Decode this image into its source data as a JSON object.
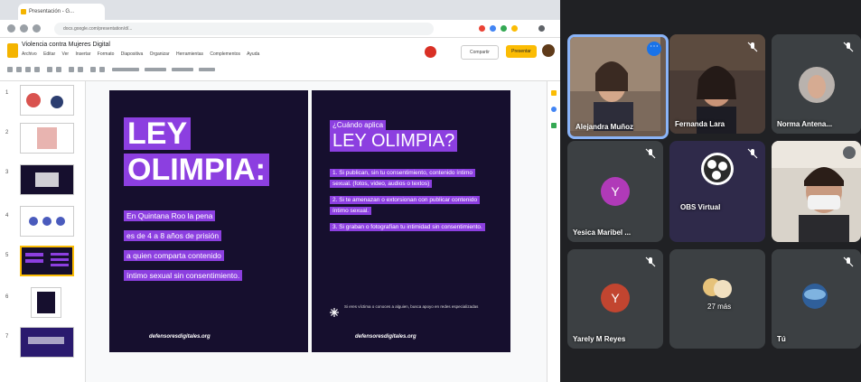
{
  "browser": {
    "tab_title": "Presentación - G...",
    "url": "docs.google.com/presentation/d/..."
  },
  "slides_app": {
    "doc_title": "Violencia contra Mujeres Digital",
    "menu": [
      "Archivo",
      "Editar",
      "Ver",
      "Insertar",
      "Formato",
      "Diapositiva",
      "Organizar",
      "Herramientas",
      "Complementos",
      "Ayuda"
    ],
    "share_label": "Compartir",
    "present_label": "Presentar",
    "thumb_numbers": [
      "1",
      "2",
      "3",
      "4",
      "5",
      "6",
      "7"
    ]
  },
  "slide_left": {
    "title_line1": "LEY",
    "title_line2": "OLIMPIA:",
    "body_lines": [
      "En Quintana Roo la pena",
      "es de 4 a 8 años de prisión",
      "a quien comparta contenido",
      "íntimo sexual sin consentimiento."
    ],
    "footer": "defensoresdigitales.org"
  },
  "slide_right": {
    "kicker": "¿Cuándo aplica",
    "title": "LEY OLIMPIA?",
    "points": [
      "1. Si publican, sin tu consentimiento, contenido íntimo sexual. (fotos, video, audios o textos)",
      "2. Si te amenazan o extorsionan con publicar contenido íntimo sexual.",
      "3. Si graban o fotografían tu intimidad sin consentimiento."
    ],
    "note": "Si eres víctima o conoces a alguien, busca apoyo en redes especializadas",
    "footer": "defensoresdigitales.org"
  },
  "participants": [
    {
      "name": "Alejandra Muñoz",
      "type": "video",
      "active": true,
      "muted": false,
      "more_menu": true
    },
    {
      "name": "Fernanda Lara",
      "type": "video",
      "active": false,
      "muted": true
    },
    {
      "name": "Norma Antena...",
      "type": "video",
      "active": false,
      "muted": true
    },
    {
      "name": "Yesica Maribel ...",
      "type": "avatar",
      "initial": "Y",
      "avatar_color": "#b03ab8",
      "muted": true
    },
    {
      "name": "OBS Virtual",
      "type": "logo",
      "muted": true
    },
    {
      "name": "",
      "type": "video",
      "muted": false
    },
    {
      "name": "Yarely M Reyes",
      "type": "avatar",
      "initial": "Y",
      "avatar_color": "#c24530",
      "muted": true
    },
    {
      "name": "27 más",
      "type": "group",
      "muted": false
    },
    {
      "name": "Tú",
      "type": "video",
      "muted": true
    }
  ],
  "colors": {
    "slide_bg": "#160f2e",
    "highlight": "#8c3fe0",
    "meet_bg": "#202124",
    "tile_bg": "#3c4043",
    "active_border": "#8ab4f8"
  }
}
